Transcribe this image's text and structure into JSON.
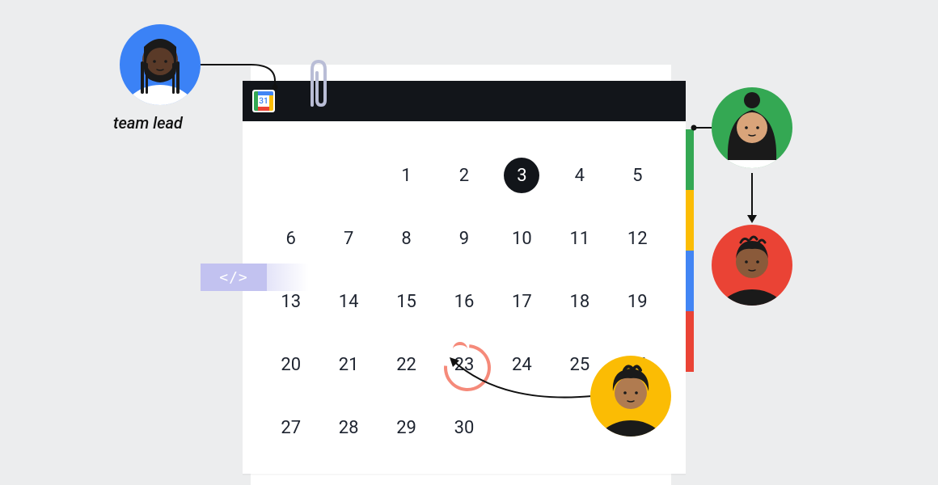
{
  "app_icon_day": "31",
  "lead_label": "team lead",
  "code_tag": "</>",
  "calendar": {
    "leading_blanks": 2,
    "days": [
      1,
      2,
      3,
      4,
      5,
      6,
      7,
      8,
      9,
      10,
      11,
      12,
      13,
      14,
      15,
      16,
      17,
      18,
      19,
      20,
      21,
      22,
      23,
      24,
      25,
      26,
      27,
      28,
      29,
      30
    ],
    "selected": 3,
    "circled": 23
  },
  "avatars": {
    "lead": {
      "bg": "#3b82f6"
    },
    "green": {
      "bg": "#34a853"
    },
    "red": {
      "bg": "#ea4335"
    },
    "yellow": {
      "bg": "#fbbc04"
    }
  },
  "tab_colors": [
    "green",
    "yellow",
    "blue",
    "red"
  ]
}
